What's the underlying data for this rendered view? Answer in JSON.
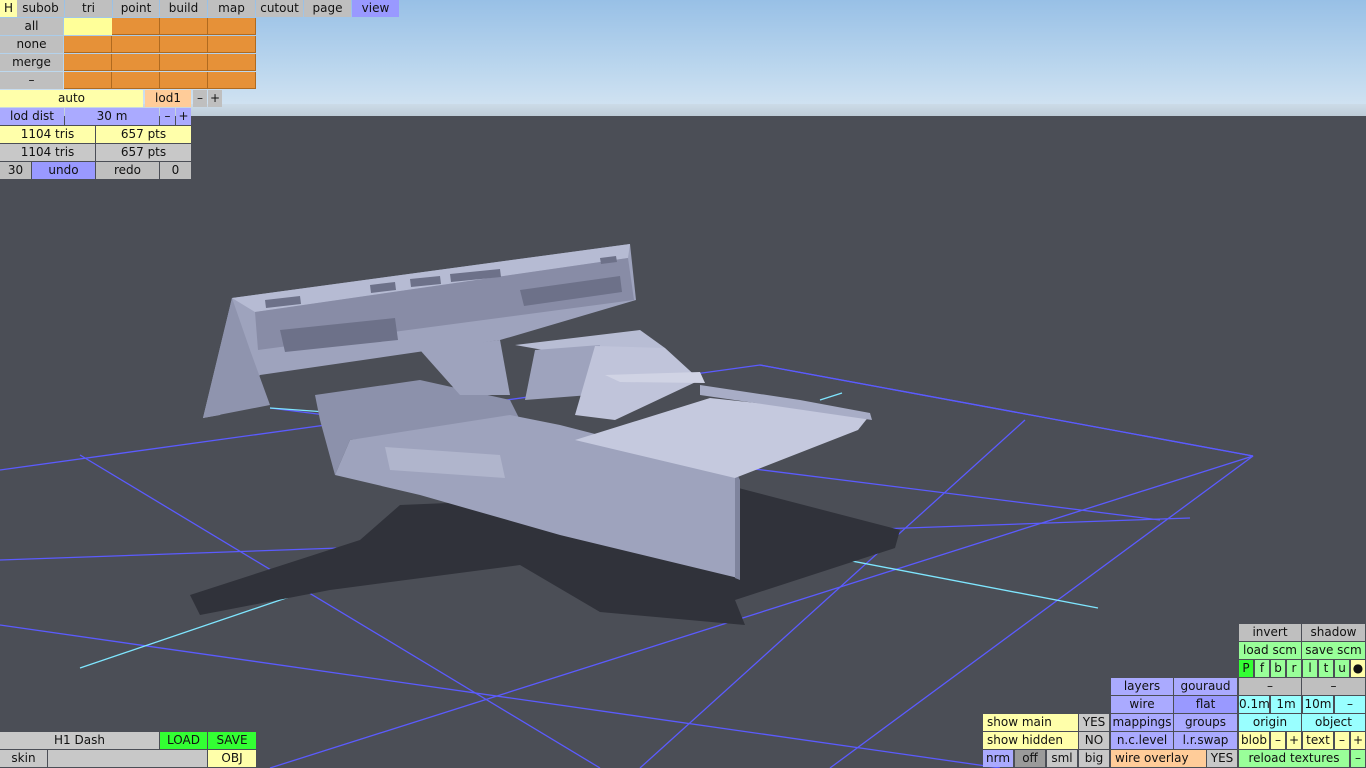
{
  "tabs": [
    "H",
    "subob",
    "tri",
    "point",
    "build",
    "map",
    "cutout",
    "page",
    "view"
  ],
  "subob_rows": [
    "all",
    "none",
    "merge",
    "–"
  ],
  "lod": {
    "mode": "auto",
    "level": "lod1",
    "minus": "–",
    "plus": "+"
  },
  "lod_dist": {
    "label": "lod dist",
    "value": "30 m",
    "minus": "–",
    "plus": "+"
  },
  "stats": [
    {
      "tris": "1104 tris",
      "pts": "657 pts"
    },
    {
      "tris": "1104 tris",
      "pts": "657 pts"
    }
  ],
  "undo_row": {
    "count": "30",
    "undo": "undo",
    "redo": "redo",
    "redo_count": "0"
  },
  "file": {
    "name": "H1 Dash",
    "load": "LOAD",
    "save": "SAVE",
    "skin": "skin",
    "obj": "OBJ"
  },
  "view_panel": {
    "invert": "invert",
    "shadow": "shadow",
    "load_scm": "load scm",
    "save_scm": "save scm",
    "views": [
      "P",
      "f",
      "b",
      "r",
      "l",
      "t",
      "u",
      "●"
    ],
    "minus": "–",
    "plus": "+",
    "layers": "layers",
    "gouraud": "gouraud",
    "wire": "wire",
    "flat": "flat",
    "grid": [
      "0.1m",
      "1m",
      "10m"
    ],
    "show_main": "show main",
    "show_main_val": "YES",
    "mappings": "mappings",
    "groups": "groups",
    "origin": "origin",
    "object": "object",
    "show_hidden": "show hidden",
    "show_hidden_val": "NO",
    "nc_level": "n.c.level",
    "lr_swap": "l.r.swap",
    "blob": "blob",
    "text": "text",
    "nrm": "nrm",
    "off": "off",
    "sml": "sml",
    "big": "big",
    "wire_overlay": "wire overlay",
    "wire_overlay_val": "YES",
    "reload_textures": "reload textures"
  },
  "colors": {
    "sky": "#bcd7ee",
    "ground": "#4b4e56",
    "model": "#a7acc6",
    "grid_blue": "#5b5bff",
    "grid_cyan": "#7fe6ff"
  }
}
